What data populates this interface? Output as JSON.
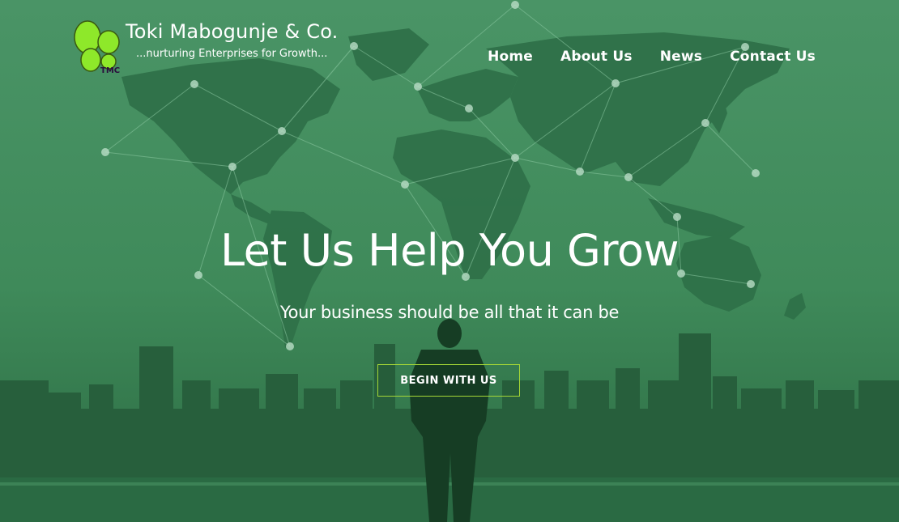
{
  "brand": {
    "logo_text": "TMC",
    "name": "Toki Mabogunje & Co.",
    "tagline": "...nurturing Enterprises for Growth..."
  },
  "nav": {
    "items": [
      {
        "label": "Home"
      },
      {
        "label": "About Us"
      },
      {
        "label": "News"
      },
      {
        "label": "Contact Us"
      }
    ]
  },
  "hero": {
    "headline": "Let Us Help You Grow",
    "subheadline": "Your business should be all that it can be",
    "cta_label": "BEGIN WITH US"
  },
  "colors": {
    "overlay_green": "#3f8f5c",
    "map_land": "#2d6e46",
    "city_dark": "#1f5233",
    "logo_green": "#8ee82a",
    "cta_border": "#a4d636"
  }
}
